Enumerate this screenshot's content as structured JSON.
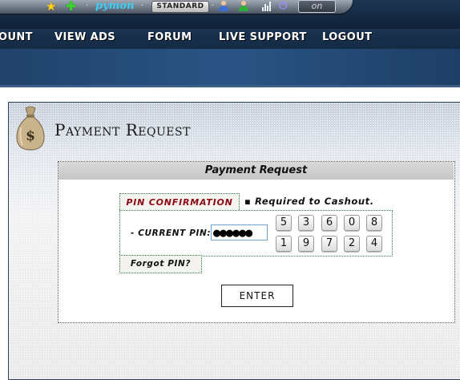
{
  "topbar": {
    "username": "pymon",
    "account_type": "STANDARD",
    "separator": "·",
    "on_label": "on",
    "icons": [
      "star-icon",
      "add-icon",
      "user-icon",
      "user-add-icon",
      "stats-icon",
      "power-icon"
    ]
  },
  "nav": {
    "items": [
      {
        "label": "OUNT"
      },
      {
        "label": "VIEW ADS"
      },
      {
        "label": "FORUM"
      },
      {
        "label": "LIVE SUPPORT"
      },
      {
        "label": "LOGOUT"
      }
    ]
  },
  "page": {
    "title": "Payment Request",
    "icon": "money-bag-icon"
  },
  "form": {
    "header": "Payment Request",
    "pin_confirmation": "PIN CONFIRMATION",
    "required_note": "▪ Required to Cashout.",
    "pin_label": "- CURRENT PIN:",
    "pin_value": "●●●●●●",
    "keypad": [
      [
        "5",
        "3",
        "6",
        "0",
        "8"
      ],
      [
        "1",
        "9",
        "7",
        "2",
        "4"
      ]
    ],
    "forgot_pin": "Forgot PIN?",
    "enter_label": "ENTER"
  },
  "colors": {
    "nav_bg": "#142b45",
    "username": "#3ecff6",
    "pin_confirmation": "#8b0a14",
    "dotted_border": "#2f7d4a"
  }
}
